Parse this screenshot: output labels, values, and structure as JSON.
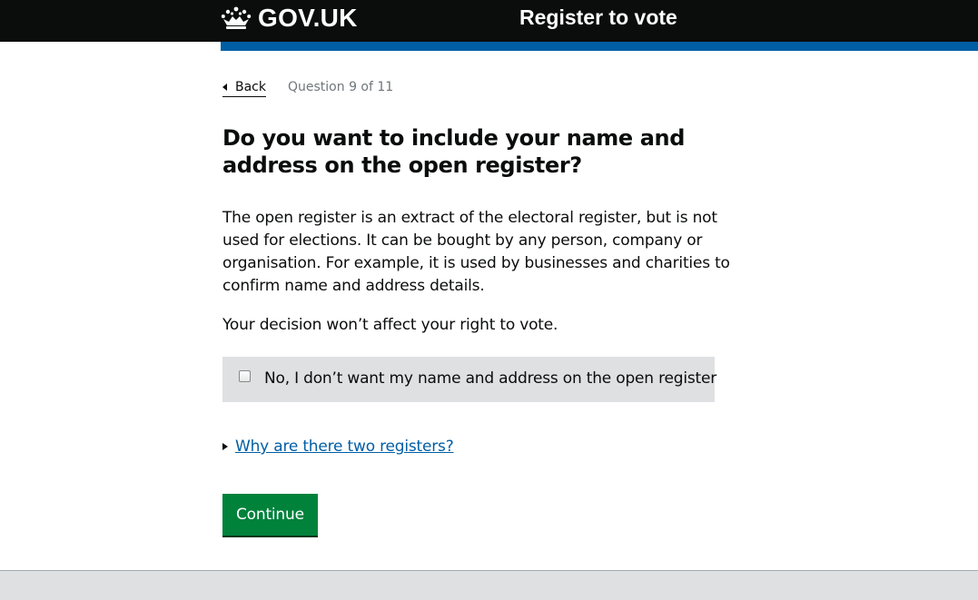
{
  "header": {
    "logo_text": "GOV.UK",
    "service_name": "Register to vote",
    "logo_icon": "crown-icon"
  },
  "nav": {
    "back_label": "Back",
    "question_count": "Question 9 of 11"
  },
  "main": {
    "heading": "Do you want to include your name and address on the open register?",
    "paragraph_1": "The open register is an extract of the electoral register, but is not used for elections. It can be bought by any person, company or organisation. For example, it is used by businesses and charities to confirm name and address details.",
    "paragraph_2": "Your decision won’t affect your right to vote.",
    "checkbox_label": "No, I don’t want my name and address on the open register",
    "checkbox_checked": false,
    "details_summary": "Why are there two registers?",
    "continue_label": "Continue"
  },
  "colors": {
    "header_bg": "#0b0c0c",
    "accent_bar": "#005ea5",
    "link": "#005ea5",
    "button": "#00823b",
    "checkbox_bg": "#dee0e2",
    "muted_text": "#6f777b"
  }
}
